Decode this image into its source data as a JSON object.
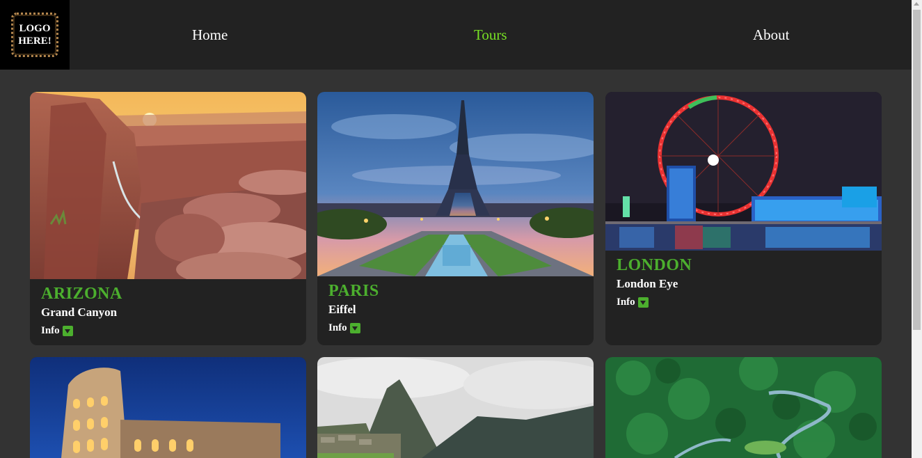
{
  "header": {
    "logo_text": "LOGO\nHERE!",
    "nav": [
      {
        "label": "Home",
        "active": false
      },
      {
        "label": "Tours",
        "active": true
      },
      {
        "label": "About",
        "active": false
      }
    ]
  },
  "colors": {
    "accent": "#4caf2e",
    "nav_active": "#77e024",
    "background": "#333333",
    "card": "#222222"
  },
  "cards": [
    {
      "title": "ARIZONA",
      "subtitle": "Grand Canyon",
      "info_label": "Info",
      "image": "grand-canyon-sunset-image"
    },
    {
      "title": "PARIS",
      "subtitle": "Eiffel",
      "info_label": "Info",
      "image": "eiffel-tower-dusk-image"
    },
    {
      "title": "LONDON",
      "subtitle": "London Eye",
      "info_label": "Info",
      "image": "london-eye-night-image"
    },
    {
      "title": "",
      "subtitle": "",
      "info_label": "",
      "image": "colosseum-night-image"
    },
    {
      "title": "",
      "subtitle": "",
      "info_label": "",
      "image": "machu-picchu-image"
    },
    {
      "title": "",
      "subtitle": "",
      "info_label": "",
      "image": "amazon-rainforest-river-image"
    }
  ]
}
